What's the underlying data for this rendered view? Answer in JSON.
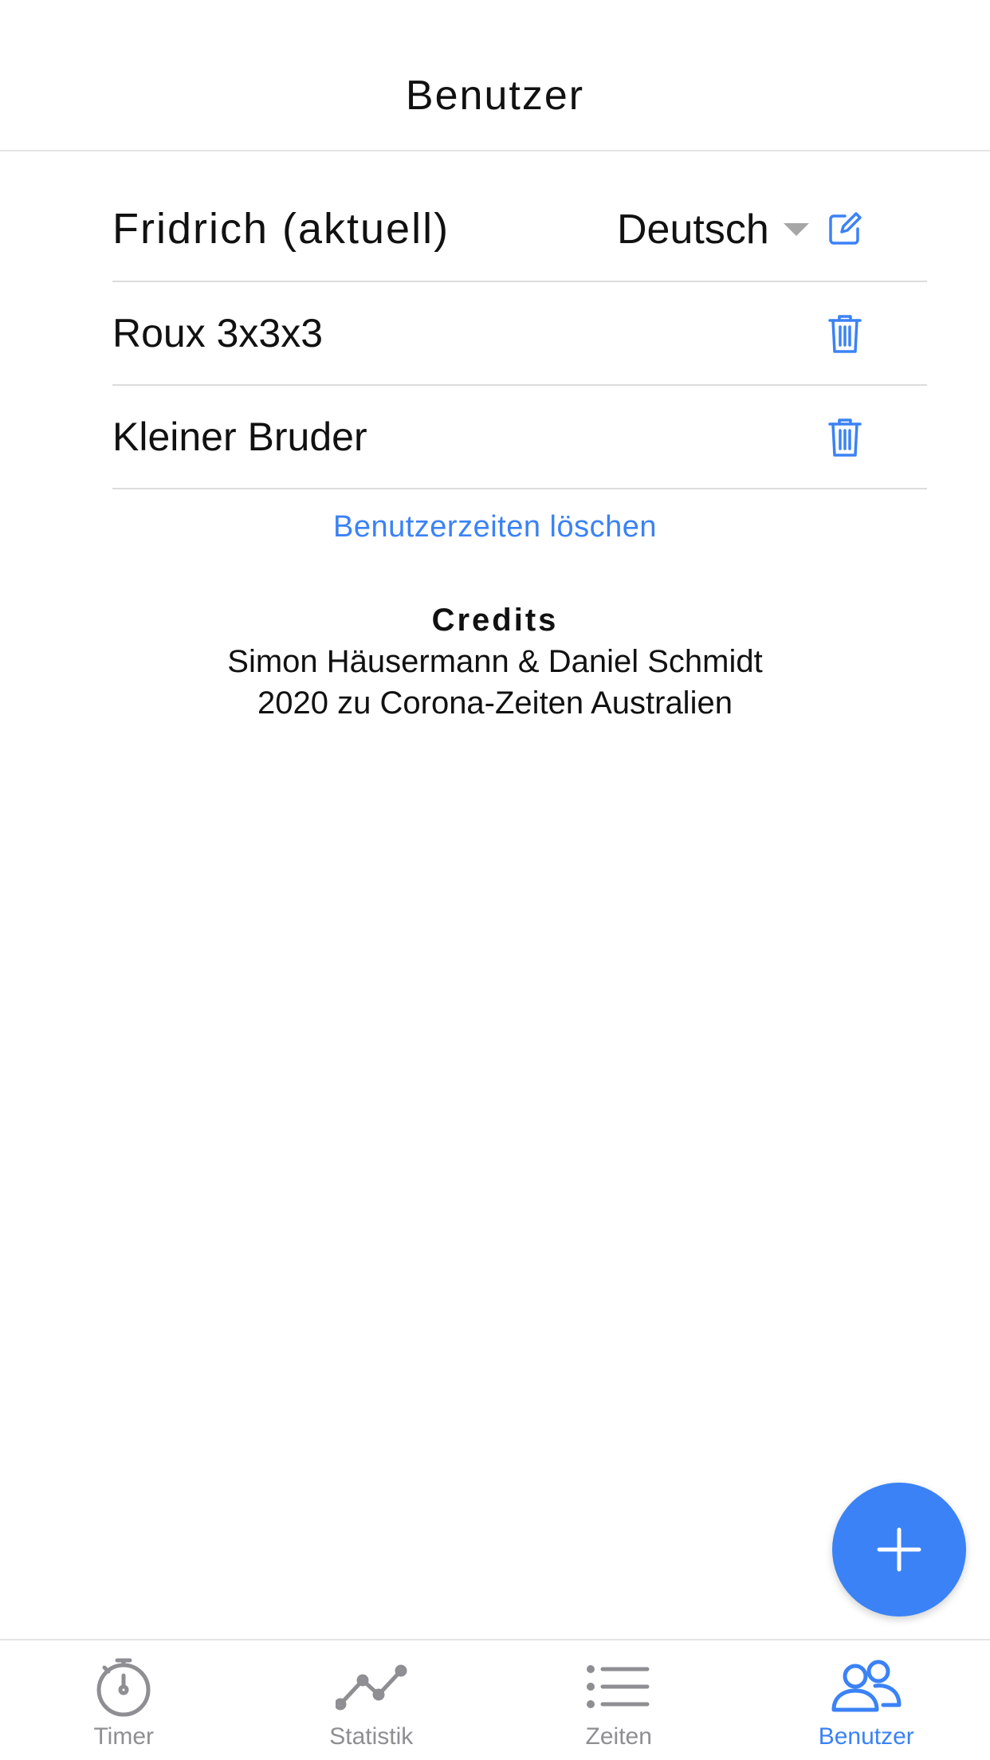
{
  "header": {
    "title": "Benutzer"
  },
  "current_user": {
    "name": "Fridrich (aktuell)",
    "language": "Deutsch"
  },
  "users": [
    {
      "name": "Roux 3x3x3"
    },
    {
      "name": "Kleiner Bruder"
    }
  ],
  "actions": {
    "delete_user_times": "Benutzerzeiten löschen"
  },
  "credits": {
    "title": "Credits",
    "line1": "Simon Häusermann & Daniel Schmidt",
    "line2": "2020 zu Corona-Zeiten Australien"
  },
  "fab": {
    "icon": "plus-icon"
  },
  "tabs": [
    {
      "label": "Timer",
      "icon": "stopwatch-icon",
      "active": false
    },
    {
      "label": "Statistik",
      "icon": "line-chart-icon",
      "active": false
    },
    {
      "label": "Zeiten",
      "icon": "list-icon",
      "active": false
    },
    {
      "label": "Benutzer",
      "icon": "users-icon",
      "active": true
    }
  ],
  "colors": {
    "accent": "#3b82f6",
    "inactive": "#8e8e93",
    "divider": "#dcdcde"
  }
}
